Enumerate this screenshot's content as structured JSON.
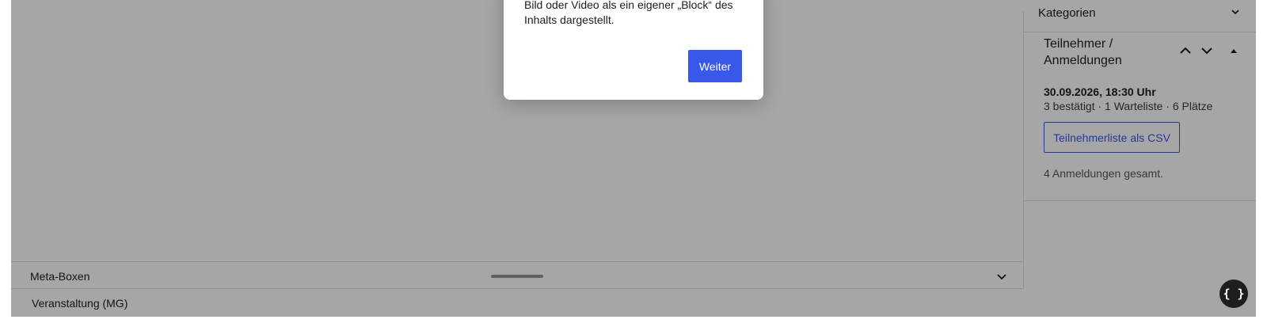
{
  "sidebar": {
    "kategorien_label": "Kategorien",
    "teilnehmer_panel": {
      "title": "Teilnehmer / Anmeldungen",
      "date": "30.09.2026, 18:30 Uhr",
      "stats": "3 bestätigt · 1 Warteliste · 6 Plätze",
      "csv_button": "Teilnehmerliste als CSV",
      "total": "4 Anmeldungen gesamt."
    }
  },
  "meta": {
    "label": "Meta-Boxen",
    "box_label": "Veranstaltung (MG)"
  },
  "modal": {
    "text_partial": "Bild oder Video als ein eigener „Block“ des Inhalts dargestellt.",
    "next_button": "Weiter"
  },
  "fab": {
    "label": "{ }"
  },
  "colors": {
    "accent": "#3858e9",
    "overlay": "rgba(0,0,0,0.35)"
  },
  "icons": [
    "chevron-down-icon",
    "chevron-up-icon",
    "triangle-up-icon"
  ]
}
